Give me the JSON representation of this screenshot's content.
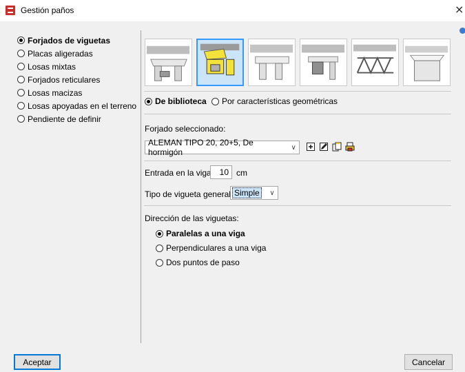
{
  "window": {
    "title": "Gestión paños",
    "close_glyph": "×",
    "app_icon": "app-logo-icon"
  },
  "categories": [
    {
      "label": "Forjados de viguetas",
      "selected": true
    },
    {
      "label": "Placas aligeradas",
      "selected": false
    },
    {
      "label": "Losas mixtas",
      "selected": false
    },
    {
      "label": "Forjados reticulares",
      "selected": false
    },
    {
      "label": "Losas macizas",
      "selected": false
    },
    {
      "label": "Losas apoyadas en el terreno",
      "selected": false
    },
    {
      "label": "Pendiente de definir",
      "selected": false
    }
  ],
  "thumbnails": {
    "count": 6,
    "selected_index": 1,
    "selection_color": "#3399ff"
  },
  "source": {
    "options": [
      {
        "label": "De biblioteca",
        "selected": true
      },
      {
        "label": "Por características geométricas",
        "selected": false
      }
    ]
  },
  "forjado": {
    "label": "Forjado seleccionado:",
    "value": "ALEMAN TIPO 20, 20+5, De hormigón",
    "tool_icons": [
      "add-icon",
      "edit-icon",
      "copy-icon",
      "print-icon"
    ]
  },
  "entrada": {
    "label": "Entrada en la viga",
    "value": "10",
    "unit": "cm"
  },
  "tipo": {
    "label": "Tipo de vigueta general",
    "value": "Simple"
  },
  "direccion": {
    "label": "Dirección de las viguetas:",
    "options": [
      {
        "label": "Paralelas a una viga",
        "selected": true
      },
      {
        "label": "Perpendiculares a una viga",
        "selected": false
      },
      {
        "label": "Dos puntos de paso",
        "selected": false
      }
    ]
  },
  "buttons": {
    "ok": "Aceptar",
    "cancel": "Cancelar"
  }
}
